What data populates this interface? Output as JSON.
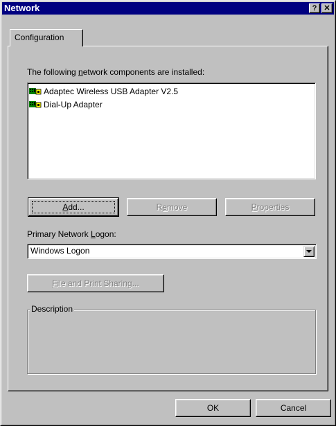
{
  "window": {
    "title": "Network",
    "help_label": "?",
    "close_label": "✕"
  },
  "tabs": [
    {
      "label": "Configuration"
    }
  ],
  "components": {
    "label_before": "The following ",
    "label_hotkey": "n",
    "label_after": "etwork components are installed:",
    "items": [
      {
        "label": "Adaptec Wireless USB Adapter V2.5",
        "icon": "network-adapter-icon"
      },
      {
        "label": "Dial-Up Adapter",
        "icon": "network-adapter-icon"
      }
    ]
  },
  "buttons": {
    "add": {
      "hotkey": "A",
      "rest": "dd..."
    },
    "remove": {
      "before": "R",
      "hotkey": "e",
      "rest": "move"
    },
    "properties": {
      "hotkey": "P",
      "rest": "roperties"
    },
    "file_print": {
      "hotkey": "F",
      "rest": "ile and Print Sharing..."
    },
    "ok": "OK",
    "cancel": "Cancel"
  },
  "logon": {
    "label_before": "Primary Network ",
    "label_hotkey": "L",
    "label_after": "ogon:",
    "value": "Windows Logon"
  },
  "description": {
    "title": "Description"
  },
  "colors": {
    "face": "#c0c0c0",
    "titlebar": "#000080",
    "window_bg": "#ffffff"
  }
}
